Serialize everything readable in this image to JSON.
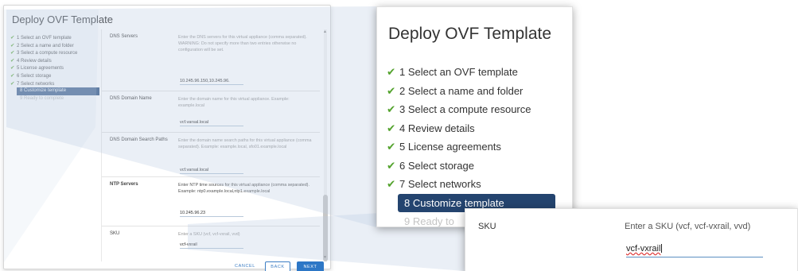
{
  "dialog": {
    "title": "Deploy OVF Template",
    "steps": [
      {
        "label": "1 Select an OVF template",
        "state": "done"
      },
      {
        "label": "2 Select a name and folder",
        "state": "done"
      },
      {
        "label": "3 Select a compute resource",
        "state": "done"
      },
      {
        "label": "4 Review details",
        "state": "done"
      },
      {
        "label": "5 License agreements",
        "state": "done"
      },
      {
        "label": "6 Select storage",
        "state": "done"
      },
      {
        "label": "7 Select networks",
        "state": "done"
      },
      {
        "label": "8 Customize template",
        "state": "active"
      },
      {
        "label": "9 Ready to complete",
        "state": "pending"
      }
    ],
    "fields": [
      {
        "label": "DNS Servers",
        "description": "Enter the DNS servers for this virtual appliance (comma separated). WARNING: Do not specify more than two entries otherwise no configuration will be set.",
        "value": "10.245.96.150,10.245.96."
      },
      {
        "label": "DNS Domain Name",
        "description": "Enter the domain name for this virtual appliance. Example: example.local",
        "value": "vcf.varsal.local"
      },
      {
        "label": "DNS Domain Search Paths",
        "description": "Enter the domain name search paths for this virtual appliance (comma separated). Example: example.local, sfo01.example.local",
        "value": "vcf.varsal.local"
      },
      {
        "label": "NTP Servers",
        "description": "Enter NTP time sources for this virtual appliance (comma separated). Example: ntp0.example.local,ntp1.example.local",
        "value": "10.245.96.23"
      },
      {
        "label": "SKU",
        "description": "Enter a SKU (vcf, vcf-vxrail, vvd)",
        "value": "vcf-vxrail"
      }
    ],
    "buttons": {
      "cancel": "CANCEL",
      "back": "BACK",
      "next": "NEXT"
    }
  },
  "zoom_steps": {
    "title": "Deploy OVF Template",
    "steps": [
      {
        "label": "1 Select an OVF template",
        "state": "done"
      },
      {
        "label": "2 Select a name and folder",
        "state": "done"
      },
      {
        "label": "3 Select a compute resource",
        "state": "done"
      },
      {
        "label": "4 Review details",
        "state": "done"
      },
      {
        "label": "5 License agreements",
        "state": "done"
      },
      {
        "label": "6 Select storage",
        "state": "done"
      },
      {
        "label": "7 Select networks",
        "state": "done"
      },
      {
        "label": "8 Customize template",
        "state": "active"
      },
      {
        "label": "9 Ready to",
        "state": "pending"
      }
    ]
  },
  "zoom_sku": {
    "label": "SKU",
    "description": "Enter a SKU (vcf, vcf-vxrail, vvd)",
    "value": "vcf-vxrail"
  },
  "icons": {
    "done": "check-icon",
    "scroll_up": "chevron-up-icon",
    "scroll_down": "chevron-down-icon"
  },
  "colors": {
    "check": "#5aa832",
    "active_step_bg": "#24446f",
    "primary_button": "#2d77c6",
    "callout": "#c9d6e8"
  }
}
